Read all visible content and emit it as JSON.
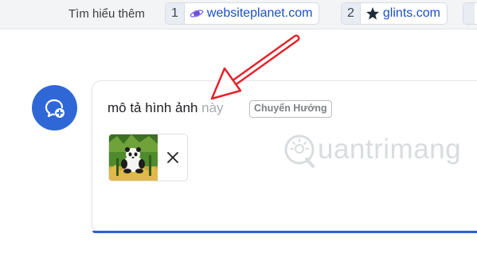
{
  "sources": {
    "learn_more": "Tìm hiểu thêm",
    "items": [
      {
        "index": "1",
        "site": "websiteplanet.com",
        "icon": "planet-icon"
      },
      {
        "index": "2",
        "site": "glints.com",
        "icon": "star-icon"
      }
    ]
  },
  "composer": {
    "typed_text": "mô tả hình ảnh",
    "suggestion_text": " này",
    "tab_hint": "Chuyển Hướng",
    "attachment": {
      "thumbnail": "panda-image",
      "remove_icon": "close-icon"
    }
  },
  "avatar_icon": "chat-add-icon",
  "watermark": {
    "text": "uantrimang",
    "logo_icon": "quantrimang-logo"
  },
  "colors": {
    "accent": "#2f68d6",
    "link": "#1a4fc4",
    "annotation_arrow": "#e4232b"
  }
}
